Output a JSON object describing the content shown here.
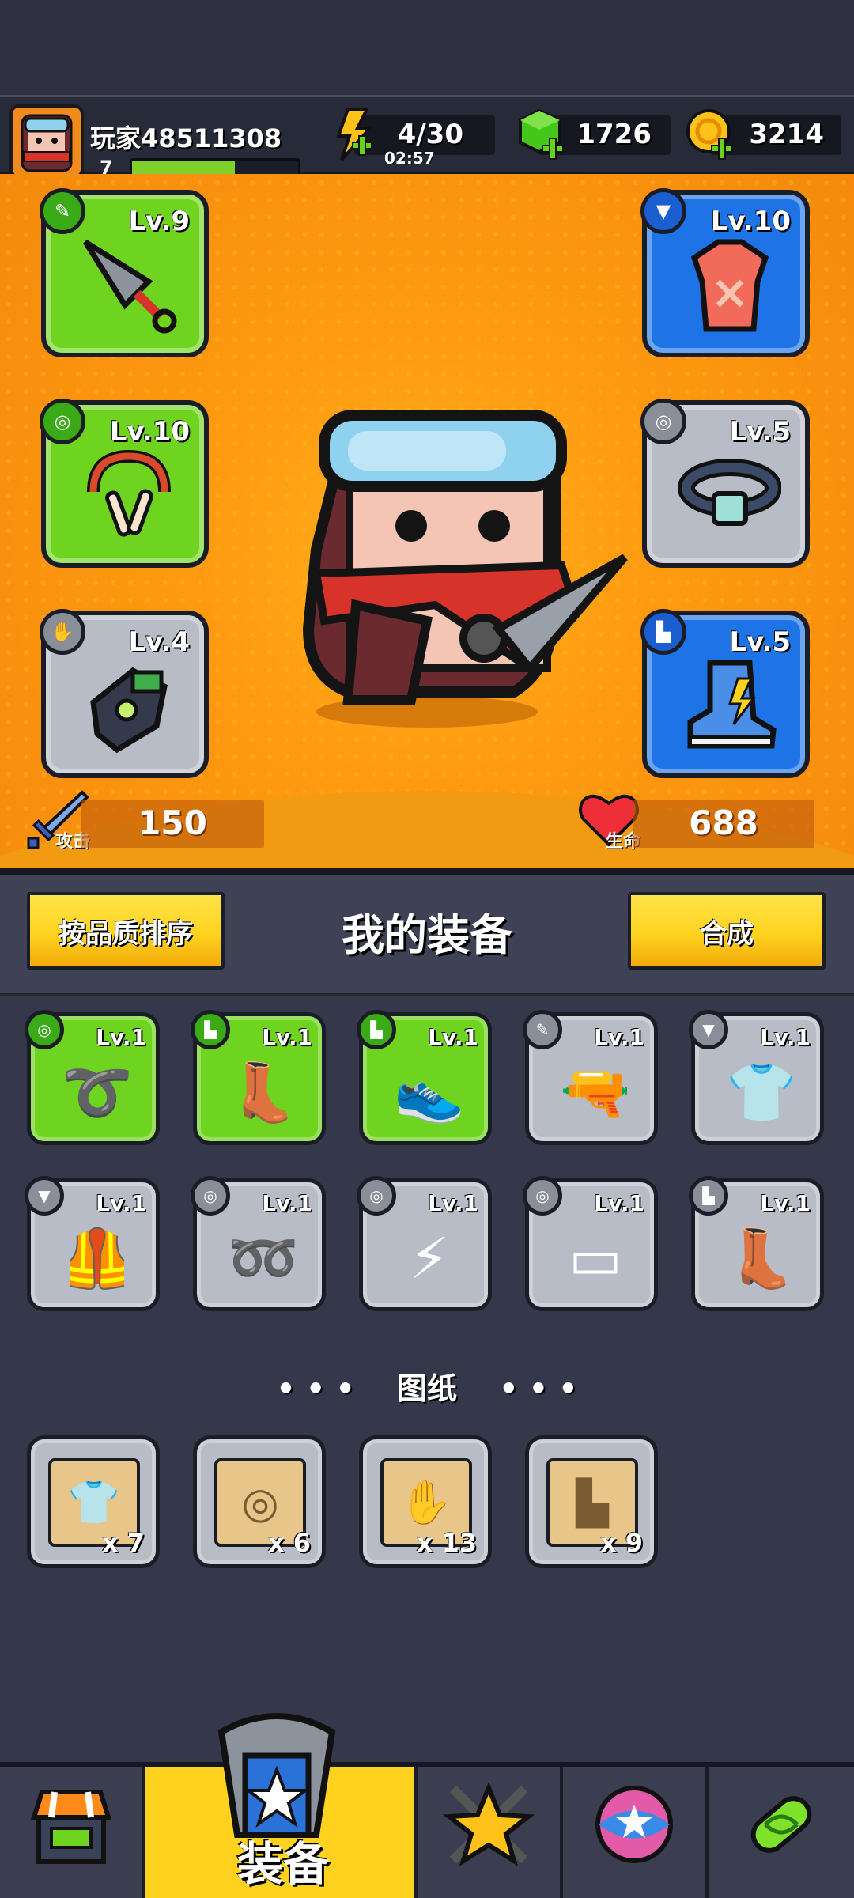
{
  "player": {
    "name": "玩家48511308",
    "level": "7",
    "xp_progress": 0.62
  },
  "resources": {
    "energy": {
      "icon": "lightning-plus-icon",
      "value": "4/30",
      "timer": "02:57"
    },
    "gems": {
      "icon": "green-gem-plus-icon",
      "value": "1726"
    },
    "coins": {
      "icon": "gold-coin-plus-icon",
      "value": "3214"
    }
  },
  "equipped": {
    "weapon": {
      "level": "Lv.9",
      "rarity": "green",
      "icon": "kunai-icon",
      "badge_icon": "weapon-slot-icon"
    },
    "armor": {
      "level": "Lv.10",
      "rarity": "blue",
      "icon": "red-shirt-icon",
      "badge_icon": "armor-slot-icon"
    },
    "necklace": {
      "level": "Lv.10",
      "rarity": "green",
      "icon": "bone-necklace-icon",
      "badge_icon": "necklace-slot-icon"
    },
    "belt": {
      "level": "Lv.5",
      "rarity": "gray",
      "icon": "belt-icon",
      "badge_icon": "belt-slot-icon"
    },
    "gloves": {
      "level": "Lv.4",
      "rarity": "gray",
      "icon": "glove-icon",
      "badge_icon": "glove-slot-icon"
    },
    "boots": {
      "level": "Lv.5",
      "rarity": "blue",
      "icon": "sneaker-icon",
      "badge_icon": "boots-slot-icon"
    }
  },
  "stats": {
    "attack": {
      "label": "攻击",
      "value": "150",
      "icon": "sword-icon"
    },
    "hp": {
      "label": "生命",
      "value": "688",
      "icon": "heart-icon"
    }
  },
  "header": {
    "sort_button": "按品质排序",
    "title": "我的装备",
    "merge_button": "合成"
  },
  "inventory": [
    {
      "level": "Lv.1",
      "rarity": "green",
      "icon": "bone-necklace-icon",
      "glyph": "➰",
      "badge": "◎"
    },
    {
      "level": "Lv.1",
      "rarity": "green",
      "icon": "boot-icon",
      "glyph": "👢",
      "badge": "▙"
    },
    {
      "level": "Lv.1",
      "rarity": "green",
      "icon": "sneaker-icon",
      "glyph": "👟",
      "badge": "▙"
    },
    {
      "level": "Lv.1",
      "rarity": "gray",
      "icon": "pistol-icon",
      "glyph": "🔫",
      "badge": "✎"
    },
    {
      "level": "Lv.1",
      "rarity": "gray",
      "icon": "red-shirt-icon",
      "glyph": "👕",
      "badge": "▼"
    },
    {
      "level": "Lv.1",
      "rarity": "gray",
      "icon": "vest-icon",
      "glyph": "🦺",
      "badge": "▼"
    },
    {
      "level": "Lv.1",
      "rarity": "gray",
      "icon": "red-belt-icon",
      "glyph": "➿",
      "badge": "◎"
    },
    {
      "level": "Lv.1",
      "rarity": "gray",
      "icon": "lightning-belt-icon",
      "glyph": "⚡",
      "badge": "◎"
    },
    {
      "level": "Lv.1",
      "rarity": "gray",
      "icon": "leather-belt-icon",
      "glyph": "▭",
      "badge": "◎"
    },
    {
      "level": "Lv.1",
      "rarity": "gray",
      "icon": "boot-icon",
      "glyph": "👢",
      "badge": "▙"
    }
  ],
  "blueprints": {
    "title": "图纸",
    "dots_left": "• • •",
    "dots_right": "• • •",
    "items": [
      {
        "icon": "shirt-blueprint-icon",
        "glyph": "👕",
        "count": "x 7"
      },
      {
        "icon": "belt-blueprint-icon",
        "glyph": "◎",
        "count": "x 6"
      },
      {
        "icon": "glove-blueprint-icon",
        "glyph": "✋",
        "count": "x 13"
      },
      {
        "icon": "boots-blueprint-icon",
        "glyph": "▙",
        "count": "x 9"
      }
    ]
  },
  "nav": {
    "active_label": "装备",
    "tabs": [
      "shop-icon",
      "equipment-icon",
      "battle-star-icon",
      "orb-icon",
      "dna-capsule-icon"
    ]
  },
  "colors": {
    "green_rarity": "#6fd41f",
    "blue_rarity": "#1e74e6",
    "gray_rarity": "#b8bcc6",
    "arena": "#ff9a10",
    "button_yellow": "#ffd31f"
  }
}
